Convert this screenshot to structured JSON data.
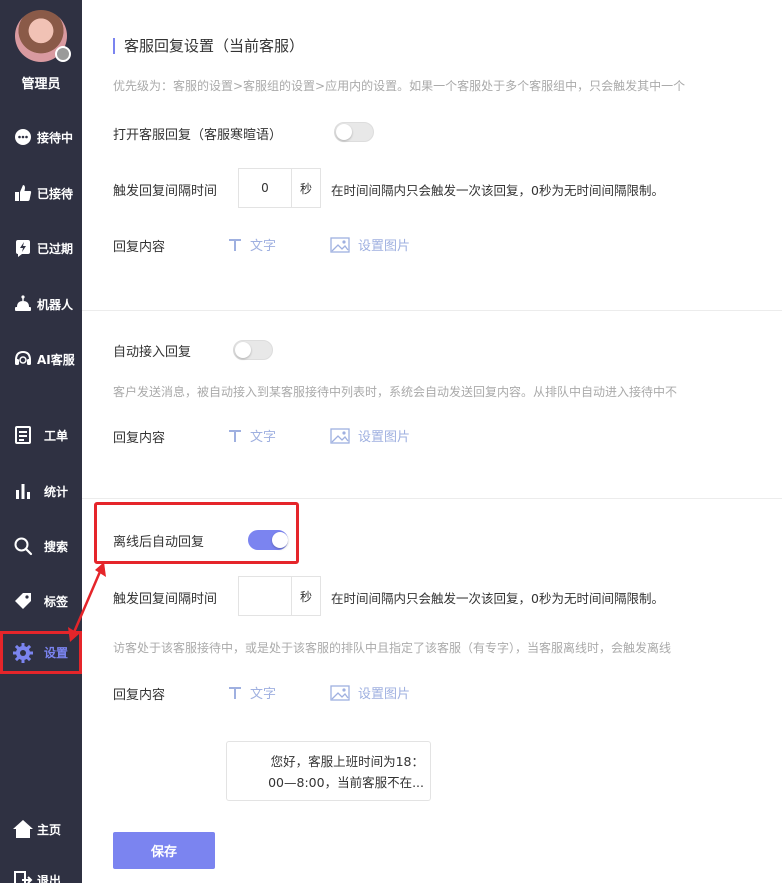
{
  "sidebar": {
    "user_name": "管理员",
    "items": [
      {
        "label": "接待中",
        "icon": "chat-bubble-icon"
      },
      {
        "label": "已接待",
        "icon": "thumbs-up-icon"
      },
      {
        "label": "已过期",
        "icon": "lightning-icon"
      },
      {
        "label": "机器人",
        "icon": "robot-icon"
      },
      {
        "label": "AI客服",
        "icon": "headset-icon"
      },
      {
        "label": "工单",
        "icon": "form-icon"
      },
      {
        "label": "统计",
        "icon": "bar-chart-icon"
      },
      {
        "label": "搜索",
        "icon": "search-icon"
      },
      {
        "label": "标签",
        "icon": "tag-icon"
      },
      {
        "label": "设置",
        "icon": "gear-icon"
      },
      {
        "label": "主页",
        "icon": "home-icon"
      },
      {
        "label": "退出",
        "icon": "logout-icon"
      }
    ],
    "active_item": "设置"
  },
  "main": {
    "section_title": "客服回复设置（当前客服）",
    "priority_hint": "优先级为：客服的设置>客服组的设置>应用内的设置。如果一个客服处于多个客服组中，只会触发其中一个",
    "greeting": {
      "label": "打开客服回复（客服寒暄语）",
      "enabled": false,
      "interval_label": "触发回复间隔时间",
      "interval_value": "0",
      "interval_unit": "秒",
      "interval_hint": "在时间间隔内只会触发一次该回复，0秒为无时间间隔限制。",
      "content_label": "回复内容",
      "text_link": "文字",
      "image_link": "设置图片"
    },
    "auto_accept": {
      "label": "自动接入回复",
      "enabled": false,
      "hint": "客户发送消息，被自动接入到某客服接待中列表时，系统会自动发送回复内容。从排队中自动进入接待中不",
      "content_label": "回复内容",
      "text_link": "文字",
      "image_link": "设置图片"
    },
    "offline": {
      "label": "离线后自动回复",
      "enabled": true,
      "interval_label": "触发回复间隔时间",
      "interval_value": "",
      "interval_unit": "秒",
      "interval_hint": "在时间间隔内只会触发一次该回复，0秒为无时间间隔限制。",
      "hint": "访客处于该客服接待中，或是处于该客服的排队中且指定了该客服（有专字），当客服离线时，会触发离线",
      "content_label": "回复内容",
      "text_link": "文字",
      "image_link": "设置图片",
      "message_line1": "您好，客服上班时间为18：",
      "message_line2": "00—8:00，当前客服不在..."
    },
    "save_label": "保存"
  },
  "colors": {
    "sidebar_bg": "#2f3142",
    "accent": "#7b84f0",
    "highlight_red": "#e5252a",
    "link": "#9fb0e0"
  }
}
